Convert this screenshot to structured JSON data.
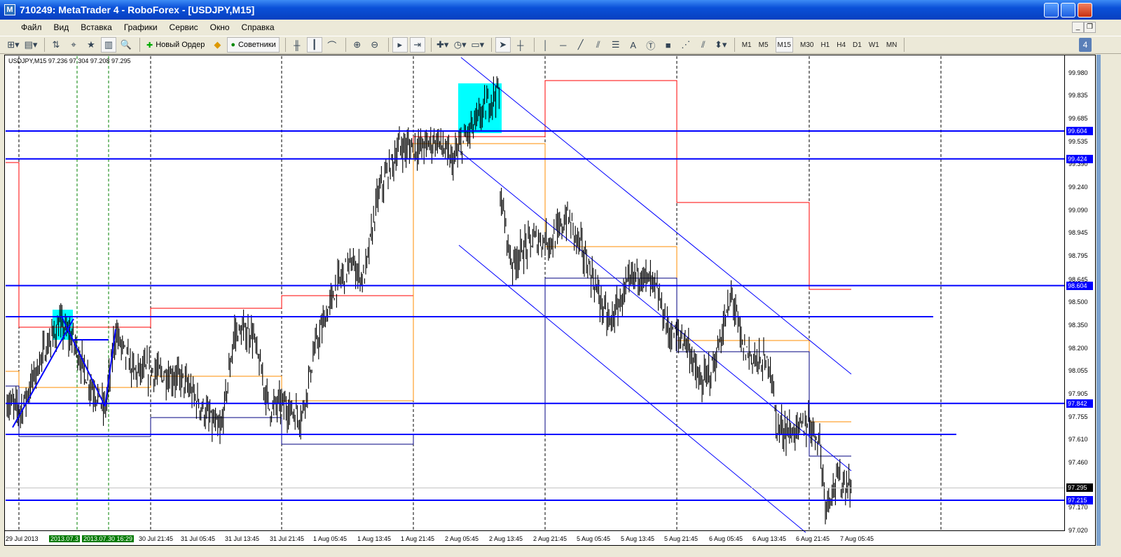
{
  "window": {
    "title": "710249: MetaTrader 4 - RoboForex - [USDJPY,M15]",
    "app_icon": "metatrader-icon"
  },
  "menu": [
    "Файл",
    "Вид",
    "Вставка",
    "Графики",
    "Сервис",
    "Окно",
    "Справка"
  ],
  "toolbar": {
    "new_order": "Новый Ордер",
    "experts": "Советники",
    "text_tool": "A",
    "timeframes": [
      "M1",
      "M5",
      "M15",
      "M30",
      "H1",
      "H4",
      "D1",
      "W1",
      "MN"
    ],
    "active_timeframe": "M15",
    "badge": "4"
  },
  "chart": {
    "info": "USDJPY,M15  97.236 97.304 97.208 97.295",
    "symbol": "USDJPY",
    "period": "M15",
    "open": 97.236,
    "high": 97.304,
    "low": 97.208,
    "close": 97.295,
    "price_ticks": [
      "99.980",
      "99.835",
      "99.685",
      "99.535",
      "99.390",
      "99.240",
      "99.090",
      "98.945",
      "98.795",
      "98.645",
      "98.500",
      "98.350",
      "98.200",
      "98.055",
      "97.905",
      "97.755",
      "97.610",
      "97.460",
      "97.170",
      "97.020"
    ],
    "hlines": [
      "99.604",
      "99.424",
      "98.604",
      "97.842",
      "97.215"
    ],
    "current_price": "97.295",
    "time_ticks": [
      "29 Jul 2013",
      "30 Jul 21:45",
      "31 Jul 05:45",
      "31 Jul 13:45",
      "31 Jul 21:45",
      "1 Aug 05:45",
      "1 Aug 13:45",
      "1 Aug 21:45",
      "2 Aug 05:45",
      "2 Aug 13:45",
      "2 Aug 21:45",
      "5 Aug 05:45",
      "5 Aug 13:45",
      "5 Aug 21:45",
      "6 Aug 05:45",
      "6 Aug 13:45",
      "6 Aug 21:45",
      "7 Aug 05:45"
    ],
    "time_markers": [
      "2013.07.3",
      "2013.07.30 16:29"
    ],
    "colors": {
      "hline": "#0000ff",
      "candle": "#000000",
      "level_red": "#ff0000",
      "level_orange": "#ff8c00",
      "level_navy": "#000080",
      "box": "#00ffff"
    }
  }
}
